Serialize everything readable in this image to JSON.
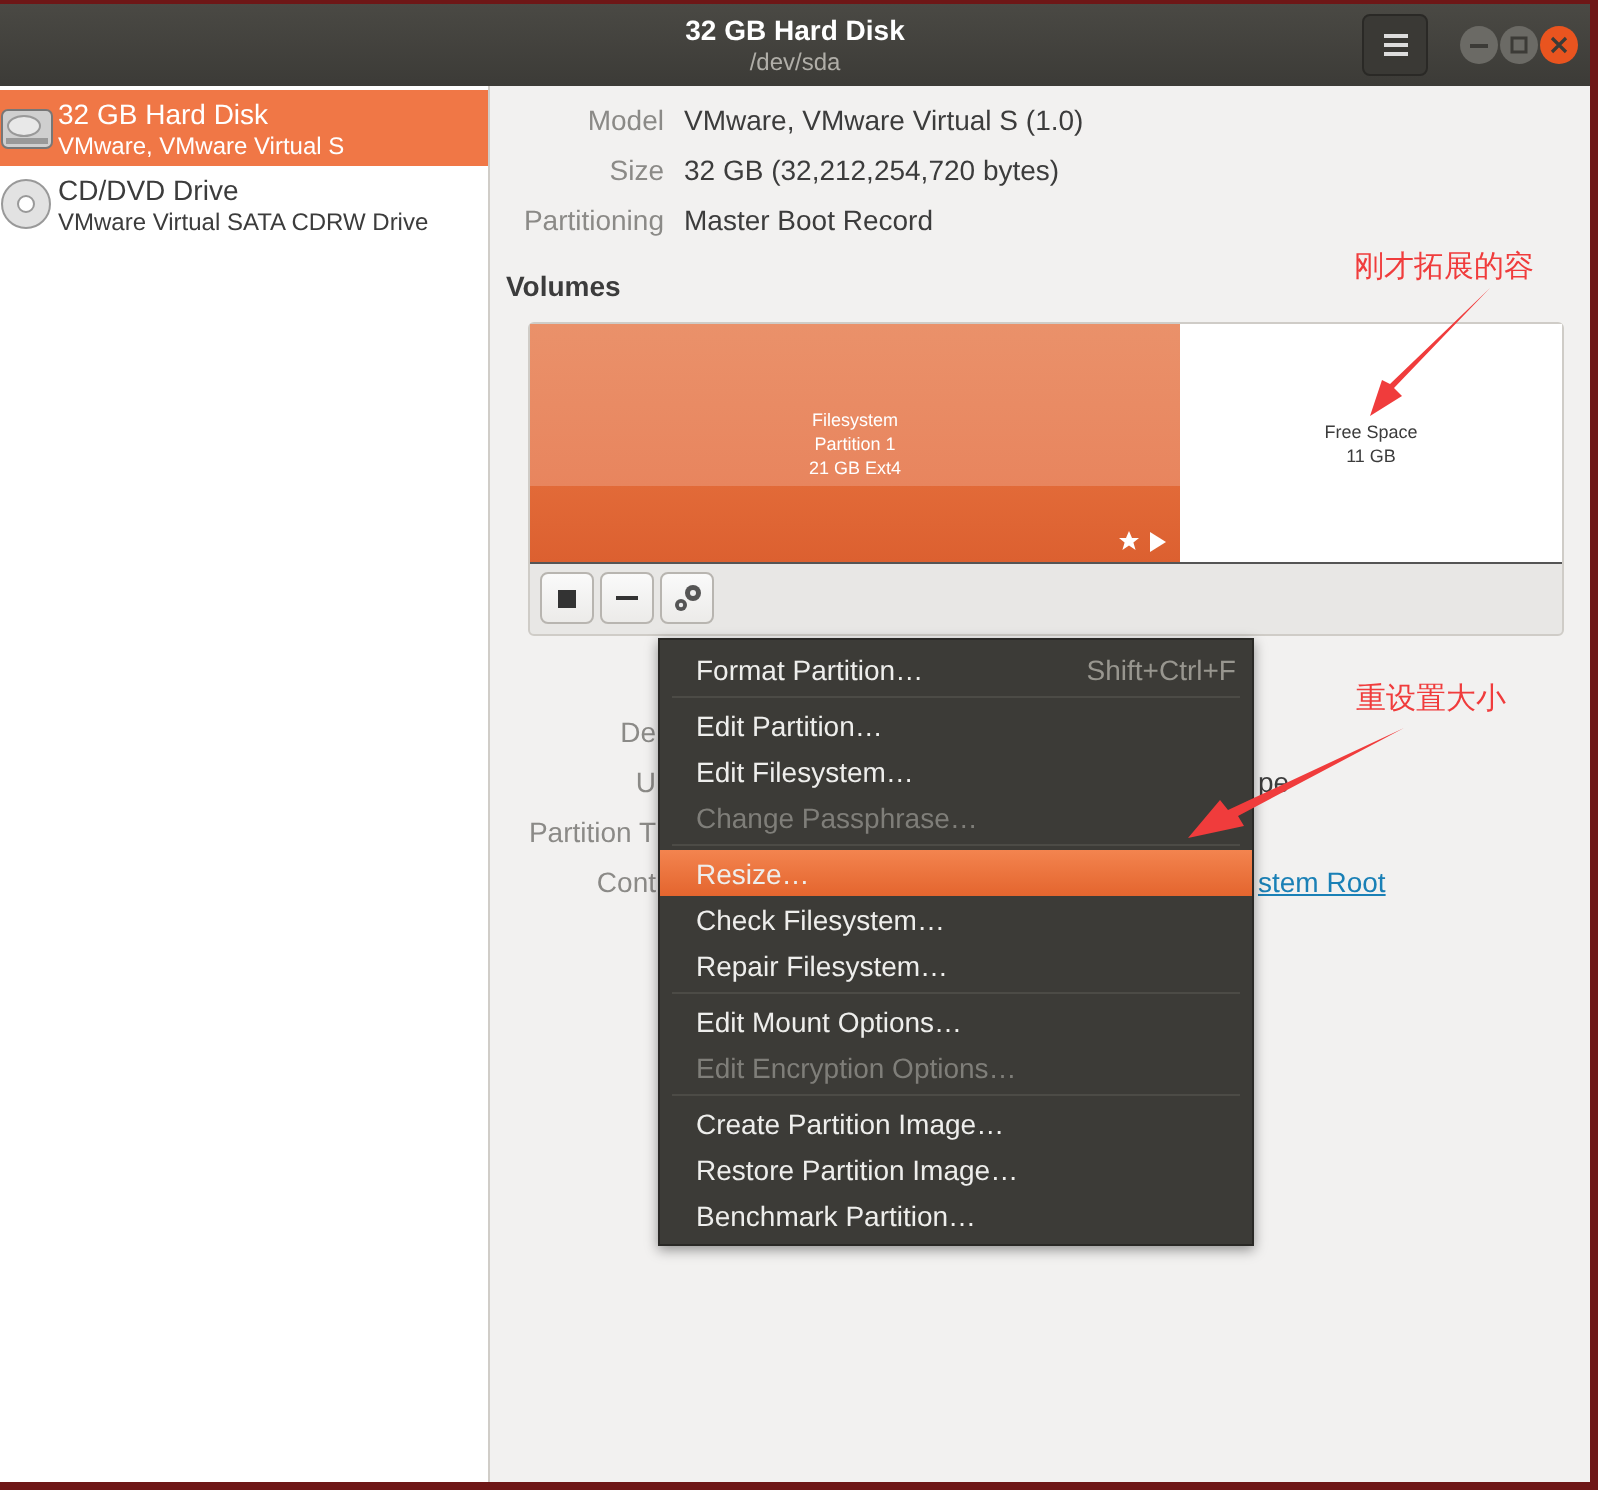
{
  "window": {
    "title": "32 GB Hard Disk",
    "subtitle": "/dev/sda"
  },
  "sidebar": {
    "items": [
      {
        "kind": "disk",
        "name": "32 GB Hard Disk",
        "detail": "VMware, VMware Virtual S",
        "selected": true
      },
      {
        "kind": "optical",
        "name": "CD/DVD Drive",
        "detail": "VMware Virtual SATA CDRW Drive",
        "selected": false
      }
    ]
  },
  "drive_info": [
    {
      "label": "Model",
      "value": "VMware, VMware Virtual S (1.0)"
    },
    {
      "label": "Size",
      "value": "32 GB (32,212,254,720 bytes)"
    },
    {
      "label": "Partitioning",
      "value": "Master Boot Record"
    }
  ],
  "volumes": {
    "heading": "Volumes",
    "items": [
      {
        "kind": "partition",
        "lines": [
          "Filesystem",
          "Partition 1",
          "21 GB Ext4"
        ],
        "selected": true
      },
      {
        "kind": "free",
        "lines": [
          "Free Space",
          "11 GB"
        ],
        "selected": false
      }
    ]
  },
  "volume_details": [
    {
      "label": "De"
    },
    {
      "label": "U",
      "value": "pe"
    },
    {
      "label": "Partition T"
    },
    {
      "label": "Cont",
      "value": "stem Root",
      "link": true
    }
  ],
  "context_menu": {
    "groups": [
      [
        {
          "label": "Format Partition…",
          "shortcut": "Shift+Ctrl+F",
          "disabled": false,
          "selected": false
        }
      ],
      [
        {
          "label": "Edit Partition…",
          "disabled": false,
          "selected": false
        },
        {
          "label": "Edit Filesystem…",
          "disabled": false,
          "selected": false
        },
        {
          "label": "Change Passphrase…",
          "disabled": true,
          "selected": false
        }
      ],
      [
        {
          "label": "Resize…",
          "disabled": false,
          "selected": true
        },
        {
          "label": "Check Filesystem…",
          "disabled": false,
          "selected": false
        },
        {
          "label": "Repair Filesystem…",
          "disabled": false,
          "selected": false
        }
      ],
      [
        {
          "label": "Edit Mount Options…",
          "disabled": false,
          "selected": false
        },
        {
          "label": "Edit Encryption Options…",
          "disabled": true,
          "selected": false
        }
      ],
      [
        {
          "label": "Create Partition Image…",
          "disabled": false,
          "selected": false
        },
        {
          "label": "Restore Partition Image…",
          "disabled": false,
          "selected": false
        },
        {
          "label": "Benchmark Partition…",
          "disabled": false,
          "selected": false
        }
      ]
    ]
  },
  "annotations": [
    {
      "text": "刚才拓展的容",
      "color": "#f03c3c"
    },
    {
      "text": "重设置大小",
      "color": "#f03c3c"
    }
  ]
}
